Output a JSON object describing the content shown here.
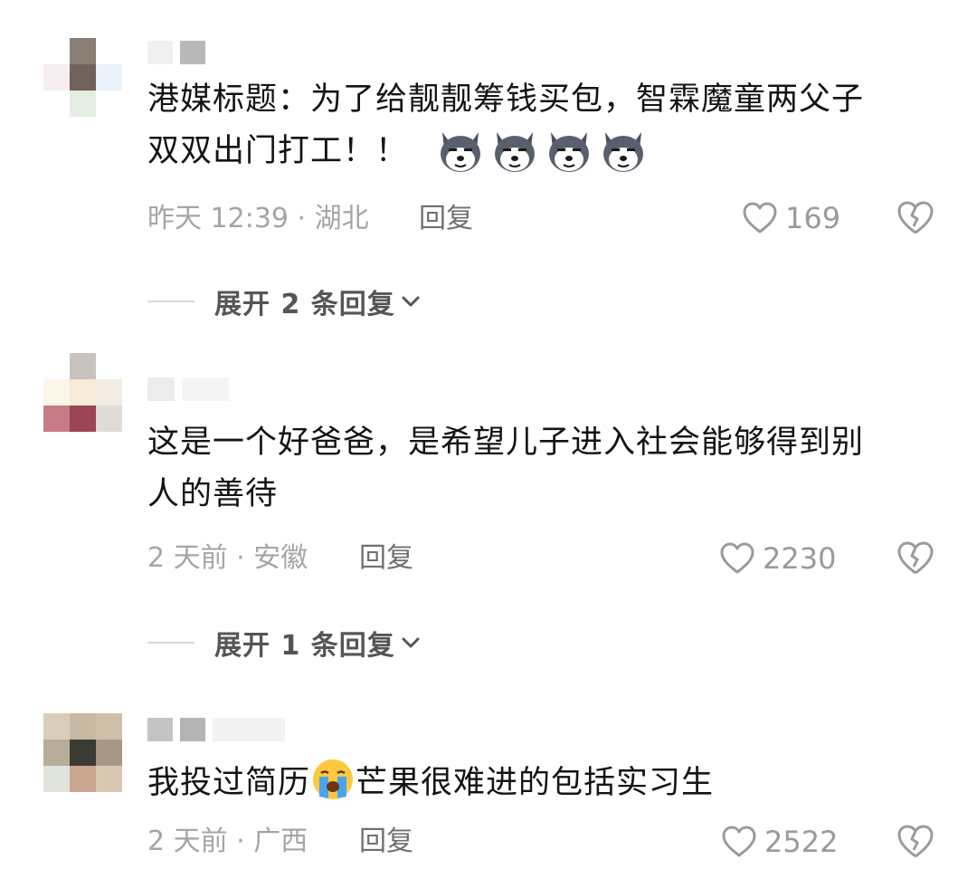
{
  "comments": [
    {
      "text_line1": "港媒标题：为了给靓靓筹钱买包，智霖魔童两父子",
      "text_line2": "双双出门打工！！",
      "emoji": [
        "husky-emoji",
        "husky-emoji",
        "husky-emoji",
        "husky-emoji"
      ],
      "meta": "昨天 12:39 · 湖北",
      "reply_label": "回复",
      "likes": "169",
      "expand_label": "展开 2 条回复"
    },
    {
      "text_line1": "这是一个好爸爸，是希望儿子进入社会能够得到别",
      "text_line2": "人的善待",
      "meta": "2 天前 · 安徽",
      "reply_label": "回复",
      "likes": "2230",
      "expand_label": "展开 1 条回复"
    },
    {
      "text_before_emoji": "我投过简历",
      "emoji": "loudly-crying-emoji",
      "text_after_emoji": "芒果很难进的包括实习生",
      "meta": "2 天前 · 广西",
      "reply_label": "回复",
      "likes": "2522"
    }
  ],
  "colors": {
    "text": "#141414",
    "meta": "#a5a5a5",
    "reply": "#6f6f6f",
    "icon": "#9a9a9a",
    "expand": "#555555"
  }
}
